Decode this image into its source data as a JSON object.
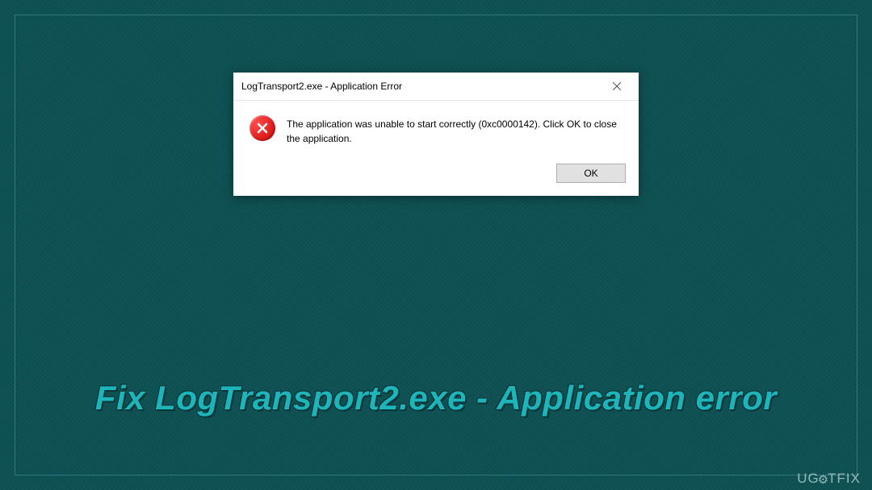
{
  "dialog": {
    "title": "LogTransport2.exe - Application Error",
    "message": "The application was unable to start correctly (0xc0000142). Click OK to close the application.",
    "ok_label": "OK"
  },
  "headline": "Fix LogTransport2.exe - Application error",
  "watermark": {
    "prefix": "UG",
    "suffix": "TFIX"
  }
}
